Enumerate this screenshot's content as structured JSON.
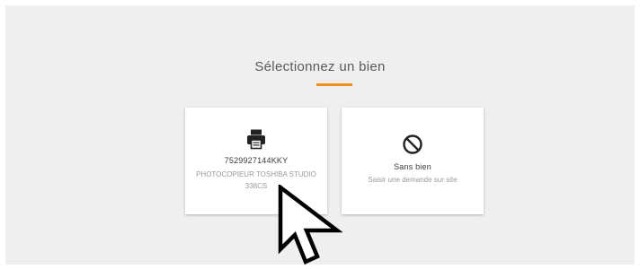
{
  "page": {
    "title": "Sélectionnez un bien",
    "accent_color": "#f0901e"
  },
  "cards": [
    {
      "icon": "printer-icon",
      "title": "7529927144KKY",
      "subtitle": "PHOTOCOPIEUR TOSHIBA STUDIO 338CS"
    },
    {
      "icon": "no-entry-icon",
      "title": "Sans bien",
      "subtitle": "Saisir une demande sur site"
    }
  ]
}
